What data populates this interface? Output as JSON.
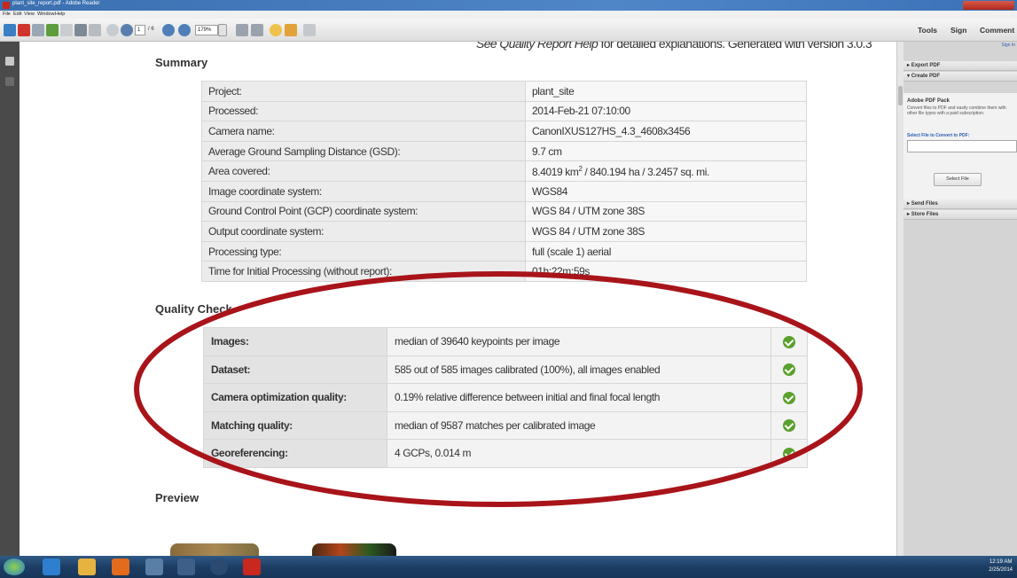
{
  "window": {
    "title": "plant_site_report.pdf - Adobe Reader"
  },
  "menu": [
    "File",
    "Edit",
    "View",
    "Window",
    "Help"
  ],
  "toolbar": {
    "page_current": "1",
    "page_total": "/ 6",
    "zoom": "179%",
    "tabs": [
      "Tools",
      "Sign",
      "Comment"
    ]
  },
  "document": {
    "header_note_italic": "See Quality Report Help",
    "header_note_rest": " for detailed explanations. Generated with version 3.0.3",
    "summary": {
      "title": "Summary",
      "rows": [
        {
          "label": "Project:",
          "value": "plant_site"
        },
        {
          "label": "Processed:",
          "value": "2014-Feb-21 07:10:00"
        },
        {
          "label": "Camera name:",
          "value": "CanonIXUS127HS_4.3_4608x3456"
        },
        {
          "label": "Average Ground Sampling Distance (GSD):",
          "value": "9.7 cm"
        },
        {
          "label": "Area covered:",
          "value_prefix": "8.4019 km",
          "value_sup": "2",
          "value_suffix": " / 840.194 ha / 3.2457 sq. mi."
        },
        {
          "label": "Image coordinate system:",
          "value": "WGS84"
        },
        {
          "label": "Ground Control Point (GCP) coordinate system:",
          "value": "WGS 84 / UTM zone 38S"
        },
        {
          "label": "Output coordinate system:",
          "value": "WGS 84 / UTM zone 38S"
        },
        {
          "label": "Processing type:",
          "value": "full (scale 1) aerial"
        },
        {
          "label": "Time for Initial Processing (without report):",
          "value": "01h:22m:59s"
        }
      ]
    },
    "quality": {
      "title": "Quality Check",
      "rows": [
        {
          "label": "Images:",
          "value": "median of 39640 keypoints per image",
          "status": "ok"
        },
        {
          "label": "Dataset:",
          "value": "585 out of 585 images calibrated (100%), all images enabled",
          "status": "ok"
        },
        {
          "label": "Camera optimization quality:",
          "value": "0.19% relative difference between initial and final focal length",
          "status": "ok"
        },
        {
          "label": "Matching quality:",
          "value": "median of 9587 matches per calibrated image",
          "status": "ok"
        },
        {
          "label": "Georeferencing:",
          "value": "4 GCPs, 0.014 m",
          "status": "ok"
        }
      ]
    },
    "preview": {
      "title": "Preview"
    }
  },
  "right_panel": {
    "sign_in": "Sign In",
    "export_pdf": "Export PDF",
    "create_pdf": "Create PDF",
    "pack_title": "Adobe PDF Pack",
    "pack_desc": "Convert files to PDF and easily combine them with other file types with a paid subscription.",
    "select_label": "Select File to Convert to PDF:",
    "select_button": "Select File",
    "send_files": "Send Files",
    "store_files": "Store Files"
  },
  "taskbar": {
    "time": "12:19 AM",
    "date": "2/25/2014"
  },
  "colors": {
    "annotation_ellipse": "#a8141a",
    "check_green": "#5aa02c",
    "taskbar": "#1d3d63"
  }
}
